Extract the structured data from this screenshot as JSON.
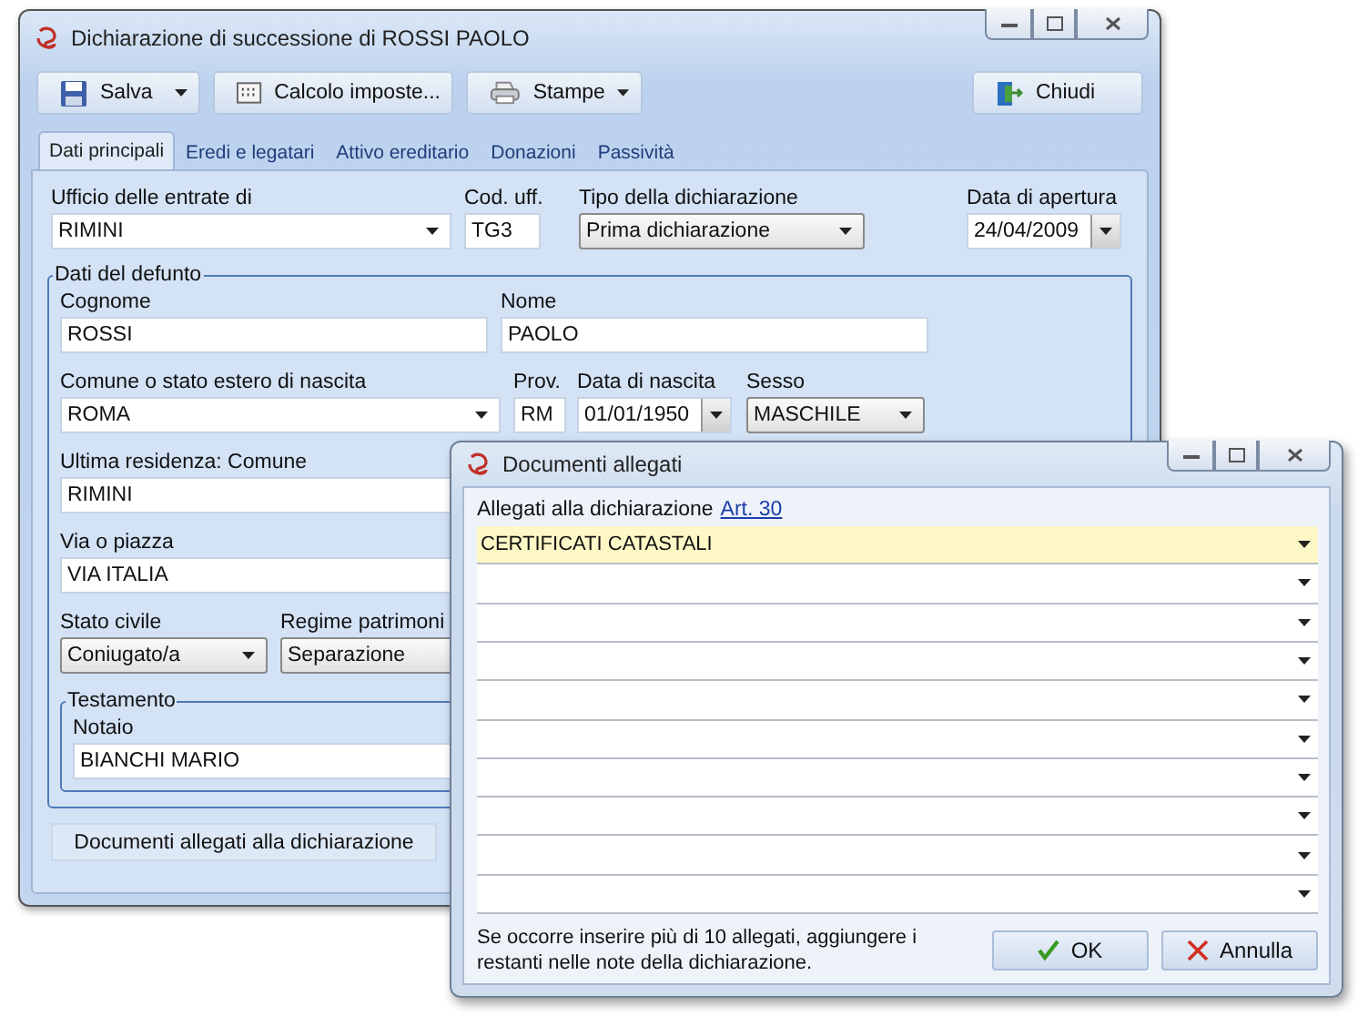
{
  "window": {
    "title": "Dichiarazione di successione di ROSSI PAOLO"
  },
  "toolbar": [
    {
      "label": "Salva",
      "menu": true
    },
    {
      "label": "Calcolo imposte...",
      "menu": false
    },
    {
      "label": "Stampe",
      "menu": true
    },
    {
      "label": "Chiudi",
      "menu": false
    }
  ],
  "tabs": [
    {
      "label": "Dati principali",
      "selected": true
    },
    {
      "label": "Eredi e legatari",
      "selected": false
    },
    {
      "label": "Attivo ereditario",
      "selected": false
    },
    {
      "label": "Donazioni",
      "selected": false
    },
    {
      "label": "Passività",
      "selected": false
    }
  ],
  "header_fields": [
    {
      "label": "Ufficio delle entrate di",
      "value": "RIMINI",
      "kind": "combo"
    },
    {
      "label": "Cod. uff.",
      "value": "TG3",
      "kind": "text"
    },
    {
      "label": "Tipo della dichiarazione",
      "value": "Prima dichiarazione",
      "kind": "dropdown"
    },
    {
      "label": "Data di apertura",
      "value": "24/04/2009",
      "kind": "date"
    }
  ],
  "deceased": {
    "title": "Dati del defunto",
    "rows": [
      [
        {
          "label": "Cognome",
          "value": "ROSSI",
          "kind": "text"
        },
        {
          "label": "Nome",
          "value": "PAOLO",
          "kind": "text"
        }
      ],
      [
        {
          "label": "Comune o stato estero di nascita",
          "value": "ROMA",
          "kind": "combo"
        },
        {
          "label": "Prov.",
          "value": "RM",
          "kind": "text"
        },
        {
          "label": "Data di nascita",
          "value": "01/01/1950",
          "kind": "date"
        },
        {
          "label": "Sesso",
          "value": "MASCHILE",
          "kind": "dropdown"
        }
      ],
      [
        {
          "label": "Ultima residenza: Comune",
          "value": "RIMINI",
          "kind": "text"
        }
      ],
      [
        {
          "label": "Via o piazza",
          "value": "VIA ITALIA",
          "kind": "text"
        }
      ],
      [
        {
          "label": "Stato civile",
          "value": "Coniugato/a",
          "kind": "dropdown"
        },
        {
          "label": "Regime patrimoni",
          "value": "Separazione",
          "kind": "dropdown"
        }
      ]
    ]
  },
  "will": {
    "title": "Testamento",
    "fields": [
      {
        "label": "Notaio",
        "value": "BIANCHI MARIO"
      }
    ]
  },
  "attachments_button": "Documenti allegati alla dichiarazione",
  "dialog": {
    "title": "Documenti allegati",
    "caption": "Allegati alla dichiarazione",
    "link": "Art. 30",
    "rows": [
      {
        "value": "CERTIFICATI CATASTALI",
        "selected": true
      },
      {
        "selected": false
      },
      {
        "selected": false
      },
      {
        "selected": false
      },
      {
        "selected": false
      },
      {
        "selected": false
      },
      {
        "selected": false
      },
      {
        "selected": false
      },
      {
        "selected": false
      },
      {
        "selected": false
      }
    ],
    "note": "Se occorre inserire più di 10 allegati, aggiungere i restanti nelle note della dichiarazione.",
    "buttons": [
      {
        "label": "OK"
      },
      {
        "label": "Annulla"
      }
    ]
  }
}
